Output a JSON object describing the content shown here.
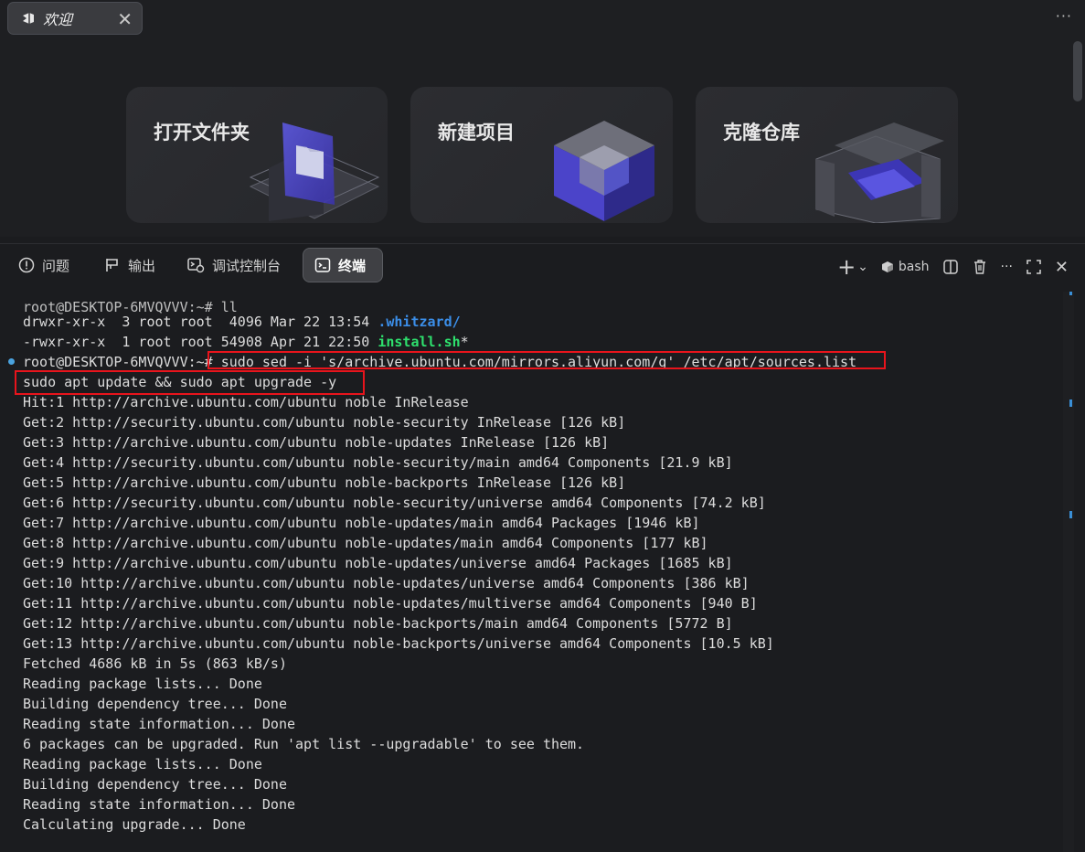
{
  "editor": {
    "tab": {
      "icon": "vscode-logo-icon",
      "title": "欢迎",
      "close": "✕"
    },
    "more": "···",
    "actions": [
      {
        "label": "打开文件夹",
        "icon": "open-folder-illustration"
      },
      {
        "label": "新建项目",
        "icon": "new-project-cube-illustration"
      },
      {
        "label": "克隆仓库",
        "icon": "clone-repo-illustration"
      }
    ]
  },
  "panel": {
    "tabs": [
      {
        "label": "问题",
        "icon": "problems-icon"
      },
      {
        "label": "输出",
        "icon": "output-icon"
      },
      {
        "label": "调试控制台",
        "icon": "debug-console-icon"
      },
      {
        "label": "终端",
        "icon": "terminal-icon",
        "active": true
      }
    ],
    "toolbar": {
      "add": "+",
      "dropdown": "⌄",
      "shell": "bash",
      "more": "···",
      "close": "✕"
    }
  },
  "terminal": {
    "lines": [
      "root@DESKTOP-6MVQVVV:~# ll",
      "drwxr-xr-x  3 root root  4096 Mar 22 13:54 ",
      ".whitzard/",
      "-rwxr-xr-x  1 root root 54908 Apr 21 22:50 ",
      "install.sh",
      "*",
      "root@DESKTOP-6MVQVVV:~# sudo sed -i 's/archive.ubuntu.com/mirrors.aliyun.com/g' /etc/apt/sources.list",
      "sudo apt update && sudo apt upgrade -y",
      "Hit:1 http://archive.ubuntu.com/ubuntu noble InRelease",
      "Get:2 http://security.ubuntu.com/ubuntu noble-security InRelease [126 kB]",
      "Get:3 http://archive.ubuntu.com/ubuntu noble-updates InRelease [126 kB]",
      "Get:4 http://security.ubuntu.com/ubuntu noble-security/main amd64 Components [21.9 kB]",
      "Get:5 http://archive.ubuntu.com/ubuntu noble-backports InRelease [126 kB]",
      "Get:6 http://security.ubuntu.com/ubuntu noble-security/universe amd64 Components [74.2 kB]",
      "Get:7 http://archive.ubuntu.com/ubuntu noble-updates/main amd64 Packages [1946 kB]",
      "Get:8 http://archive.ubuntu.com/ubuntu noble-updates/main amd64 Components [177 kB]",
      "Get:9 http://archive.ubuntu.com/ubuntu noble-updates/universe amd64 Packages [1685 kB]",
      "Get:10 http://archive.ubuntu.com/ubuntu noble-updates/universe amd64 Components [386 kB]",
      "Get:11 http://archive.ubuntu.com/ubuntu noble-updates/multiverse amd64 Components [940 B]",
      "Get:12 http://archive.ubuntu.com/ubuntu noble-backports/main amd64 Components [5772 B]",
      "Get:13 http://archive.ubuntu.com/ubuntu noble-backports/universe amd64 Components [10.5 kB]",
      "Fetched 4686 kB in 5s (863 kB/s)",
      "Reading package lists... Done",
      "Building dependency tree... Done",
      "Reading state information... Done",
      "6 packages can be upgraded. Run 'apt list --upgradable' to see them.",
      "Reading package lists... Done",
      "Building dependency tree... Done",
      "Reading state information... Done",
      "Calculating upgrade... Done"
    ]
  },
  "colors": {
    "highlight_box": "#e8141c",
    "executable": "#2ee06d",
    "directory": "#3b8ee8",
    "command_dot": "#4aa3df"
  }
}
